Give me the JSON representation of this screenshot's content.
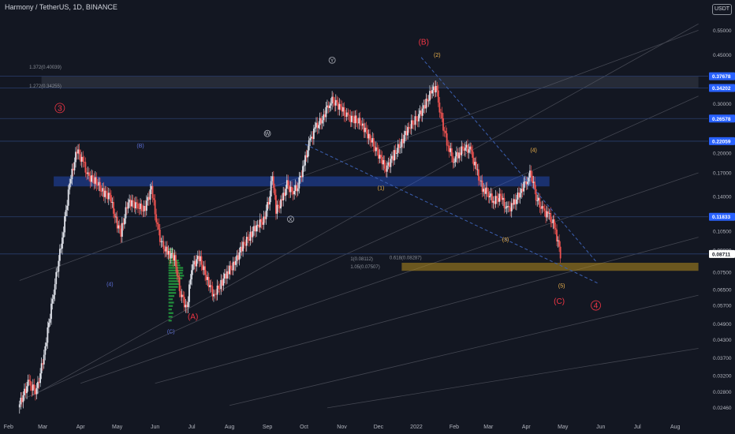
{
  "header": {
    "title": "Harmony / TetherUS, 1D, BINANCE",
    "currency": "USDT"
  },
  "colors": {
    "background": "#131722",
    "up": "#e0e3eb",
    "down": "#ef5350",
    "accent_blue": "#2962ff",
    "zone_blue": "#2a3f6e",
    "zone_orange": "#6b5a1e",
    "volume_profile": "#26a641",
    "label_red": "#f23645",
    "label_orange": "#f0b44c"
  },
  "chart_data": {
    "type": "candlestick",
    "yscale": "log",
    "ylim": [
      0.0225,
      0.62
    ],
    "y_ticks": [
      {
        "value": 0.55,
        "label": "0.55000"
      },
      {
        "value": 0.45,
        "label": "0.45000"
      },
      {
        "value": 0.3,
        "label": "0.30000"
      },
      {
        "value": 0.22,
        "label": "0.22000"
      },
      {
        "value": 0.2,
        "label": "0.20000"
      },
      {
        "value": 0.17,
        "label": "0.17000"
      },
      {
        "value": 0.14,
        "label": "0.14000"
      },
      {
        "value": 0.105,
        "label": "0.10500"
      },
      {
        "value": 0.09,
        "label": "0.09000"
      },
      {
        "value": 0.075,
        "label": "0.07500"
      },
      {
        "value": 0.065,
        "label": "0.06500"
      },
      {
        "value": 0.057,
        "label": "0.05700"
      },
      {
        "value": 0.049,
        "label": "0.04900"
      },
      {
        "value": 0.043,
        "label": "0.04300"
      },
      {
        "value": 0.037,
        "label": "0.03700"
      },
      {
        "value": 0.032,
        "label": "0.03200"
      },
      {
        "value": 0.028,
        "label": "0.02800"
      },
      {
        "value": 0.0246,
        "label": "0.02460"
      }
    ],
    "price_tags": [
      {
        "value": 0.37678,
        "label": "0.37678"
      },
      {
        "value": 0.34202,
        "label": "0.34202"
      },
      {
        "value": 0.26578,
        "label": "0.26578"
      },
      {
        "value": 0.22059,
        "label": "0.22059"
      },
      {
        "value": 0.11833,
        "label": "0.11833"
      },
      {
        "value": 0.08711,
        "label": "0.08711",
        "current": true
      }
    ],
    "x_ticks": [
      "Feb",
      "Mar",
      "Apr",
      "May",
      "Jun",
      "Jul",
      "Aug",
      "Sep",
      "Oct",
      "Nov",
      "Dec",
      "2022",
      "Feb",
      "Mar",
      "Apr",
      "May",
      "Jun",
      "Jul",
      "Aug"
    ],
    "price_path": [
      [
        "2021-02-10",
        0.0246
      ],
      [
        "2021-02-18",
        0.03
      ],
      [
        "2021-02-25",
        0.028
      ],
      [
        "2021-03-03",
        0.038
      ],
      [
        "2021-03-10",
        0.06
      ],
      [
        "2021-03-18",
        0.1
      ],
      [
        "2021-03-24",
        0.155
      ],
      [
        "2021-03-30",
        0.205
      ],
      [
        "2021-04-04",
        0.185
      ],
      [
        "2021-04-08",
        0.165
      ],
      [
        "2021-04-14",
        0.16
      ],
      [
        "2021-04-20",
        0.145
      ],
      [
        "2021-04-26",
        0.14
      ],
      [
        "2021-05-02",
        0.11
      ],
      [
        "2021-05-05",
        0.104
      ],
      [
        "2021-05-11",
        0.135
      ],
      [
        "2021-05-18",
        0.13
      ],
      [
        "2021-05-24",
        0.125
      ],
      [
        "2021-05-30",
        0.15
      ],
      [
        "2021-06-03",
        0.115
      ],
      [
        "2021-06-07",
        0.095
      ],
      [
        "2021-06-12",
        0.088
      ],
      [
        "2021-06-18",
        0.085
      ],
      [
        "2021-06-22",
        0.065
      ],
      [
        "2021-06-28",
        0.055
      ],
      [
        "2021-07-02",
        0.078
      ],
      [
        "2021-07-08",
        0.085
      ],
      [
        "2021-07-14",
        0.072
      ],
      [
        "2021-07-20",
        0.062
      ],
      [
        "2021-07-26",
        0.068
      ],
      [
        "2021-07-31",
        0.075
      ],
      [
        "2021-08-06",
        0.08
      ],
      [
        "2021-08-12",
        0.092
      ],
      [
        "2021-08-18",
        0.1
      ],
      [
        "2021-08-24",
        0.11
      ],
      [
        "2021-08-30",
        0.115
      ],
      [
        "2021-09-03",
        0.135
      ],
      [
        "2021-09-06",
        0.165
      ],
      [
        "2021-09-09",
        0.125
      ],
      [
        "2021-09-14",
        0.135
      ],
      [
        "2021-09-18",
        0.155
      ],
      [
        "2021-09-22",
        0.145
      ],
      [
        "2021-09-26",
        0.15
      ],
      [
        "2021-10-01",
        0.175
      ],
      [
        "2021-10-06",
        0.215
      ],
      [
        "2021-10-11",
        0.245
      ],
      [
        "2021-10-17",
        0.265
      ],
      [
        "2021-10-22",
        0.3
      ],
      [
        "2021-10-26",
        0.31
      ],
      [
        "2021-11-01",
        0.29
      ],
      [
        "2021-11-06",
        0.27
      ],
      [
        "2021-11-12",
        0.265
      ],
      [
        "2021-11-18",
        0.255
      ],
      [
        "2021-11-24",
        0.23
      ],
      [
        "2021-11-28",
        0.215
      ],
      [
        "2021-12-04",
        0.19
      ],
      [
        "2021-12-08",
        0.175
      ],
      [
        "2021-12-14",
        0.195
      ],
      [
        "2021-12-20",
        0.215
      ],
      [
        "2021-12-26",
        0.245
      ],
      [
        "2022-01-02",
        0.265
      ],
      [
        "2022-01-08",
        0.29
      ],
      [
        "2022-01-14",
        0.33
      ],
      [
        "2022-01-18",
        0.345
      ],
      [
        "2022-01-22",
        0.27
      ],
      [
        "2022-01-27",
        0.22
      ],
      [
        "2022-02-01",
        0.19
      ],
      [
        "2022-02-06",
        0.2
      ],
      [
        "2022-02-10",
        0.21
      ],
      [
        "2022-02-15",
        0.205
      ],
      [
        "2022-02-20",
        0.175
      ],
      [
        "2022-02-25",
        0.15
      ],
      [
        "2022-03-01",
        0.145
      ],
      [
        "2022-03-06",
        0.135
      ],
      [
        "2022-03-12",
        0.14
      ],
      [
        "2022-03-17",
        0.125
      ],
      [
        "2022-03-22",
        0.13
      ],
      [
        "2022-03-28",
        0.145
      ],
      [
        "2022-04-02",
        0.16
      ],
      [
        "2022-04-06",
        0.17
      ],
      [
        "2022-04-10",
        0.14
      ],
      [
        "2022-04-15",
        0.125
      ],
      [
        "2022-04-20",
        0.12
      ],
      [
        "2022-04-25",
        0.11
      ],
      [
        "2022-04-30",
        0.087
      ]
    ],
    "horizontal_lines": [
      0.37678,
      0.34202,
      0.26578,
      0.22059,
      0.11833,
      0.08711
    ],
    "zones": [
      {
        "name": "resistance-zone",
        "from_date": "2021-02-28",
        "to_date": "2022-08-20",
        "low": 0.34202,
        "high": 0.37678
      },
      {
        "name": "support-zone",
        "from_date": "2021-03-10",
        "to_date": "2022-04-20",
        "low": 0.152,
        "high": 0.165
      },
      {
        "name": "target-zone",
        "from_date": "2021-12-20",
        "to_date": "2022-08-20",
        "low": 0.0758,
        "high": 0.081
      }
    ],
    "fib_labels": [
      {
        "text": "1.372(0.40039)",
        "date": "2021-02-18",
        "value": 0.40039
      },
      {
        "text": "1.272(0.34255)",
        "date": "2021-02-18",
        "value": 0.34255
      },
      {
        "text": "1(0.08112)",
        "date": "2021-11-08",
        "value": 0.0825
      },
      {
        "text": "1.05(0.07507)",
        "date": "2021-11-08",
        "value": 0.0775
      },
      {
        "text": "0.618(0.08287)",
        "date": "2021-12-10",
        "value": 0.0835
      }
    ],
    "wave_labels": [
      {
        "text": "3",
        "date": "2021-03-15",
        "value": 0.29,
        "color": "red",
        "circle": true
      },
      {
        "text": "(B)",
        "date": "2022-01-07",
        "value": 0.5,
        "color": "red"
      },
      {
        "text": "(A)",
        "date": "2021-07-02",
        "value": 0.052,
        "color": "red"
      },
      {
        "text": "(C)",
        "date": "2022-04-28",
        "value": 0.059,
        "color": "red"
      },
      {
        "text": "4",
        "date": "2022-05-28",
        "value": 0.057,
        "color": "red",
        "circle": true
      },
      {
        "text": "(2)",
        "date": "2022-01-18",
        "value": 0.45,
        "color": "orange"
      },
      {
        "text": "(4)",
        "date": "2022-04-07",
        "value": 0.205,
        "color": "orange"
      },
      {
        "text": "(1)",
        "date": "2021-12-03",
        "value": 0.15,
        "color": "orange"
      },
      {
        "text": "(3)",
        "date": "2022-03-15",
        "value": 0.098,
        "color": "orange"
      },
      {
        "text": "(5)",
        "date": "2022-04-30",
        "value": 0.067,
        "color": "orange"
      },
      {
        "text": "Y",
        "date": "2021-10-24",
        "value": 0.43,
        "color": "gray",
        "circle": true
      },
      {
        "text": "W",
        "date": "2021-09-01",
        "value": 0.235,
        "color": "gray",
        "circle": true
      },
      {
        "text": "X",
        "date": "2021-09-20",
        "value": 0.116,
        "color": "gray",
        "circle": true
      },
      {
        "text": "(B)",
        "date": "2021-05-20",
        "value": 0.213,
        "color": "blue"
      },
      {
        "text": "(4)",
        "date": "2021-04-25",
        "value": 0.068,
        "color": "blue"
      },
      {
        "text": "(C)",
        "date": "2021-06-14",
        "value": 0.046,
        "color": "blue"
      }
    ],
    "trend_lines": [
      {
        "from": [
          "2021-10-02",
          0.215
        ],
        "to": [
          "2022-05-31",
          0.068
        ],
        "style": "dashed"
      },
      {
        "from": [
          "2022-01-05",
          0.44
        ],
        "to": [
          "2022-05-28",
          0.082
        ],
        "style": "dashed"
      },
      {
        "from": [
          "2021-02-20",
          0.027
        ],
        "to": [
          "2022-08-20",
          0.58
        ],
        "style": "channel"
      },
      {
        "from": [
          "2021-02-10",
          0.026
        ],
        "to": [
          "2022-08-20",
          0.32
        ],
        "style": "channel"
      },
      {
        "from": [
          "2021-04-01",
          0.03
        ],
        "to": [
          "2022-08-20",
          0.17
        ],
        "style": "channel"
      },
      {
        "from": [
          "2021-06-01",
          0.03
        ],
        "to": [
          "2022-08-20",
          0.1
        ],
        "style": "channel"
      },
      {
        "from": [
          "2021-08-01",
          0.025
        ],
        "to": [
          "2022-08-20",
          0.062
        ],
        "style": "channel"
      },
      {
        "from": [
          "2021-10-20",
          0.0245
        ],
        "to": [
          "2022-08-20",
          0.04
        ],
        "style": "channel"
      },
      {
        "from": [
          "2021-02-10",
          0.07
        ],
        "to": [
          "2022-08-20",
          0.55
        ],
        "style": "channel"
      }
    ]
  }
}
